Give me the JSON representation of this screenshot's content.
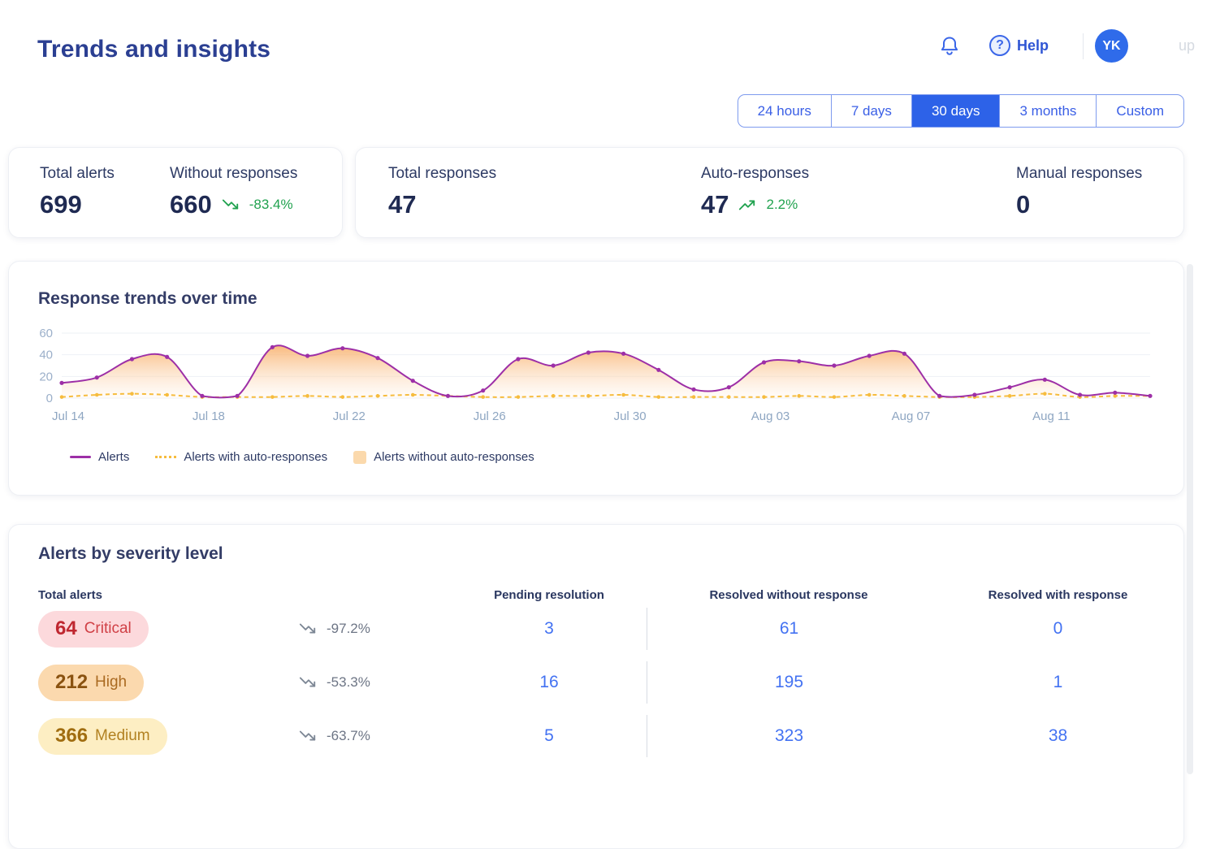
{
  "header": {
    "title": "Trends and insights",
    "help_label": "Help",
    "avatar_initials": "YK",
    "username_fragment": "up"
  },
  "time_tabs": {
    "options": [
      "24 hours",
      "7 days",
      "30 days",
      "3 months",
      "Custom"
    ],
    "active": "30 days"
  },
  "stats": {
    "total_alerts": {
      "label": "Total alerts",
      "value": "699"
    },
    "without_responses": {
      "label": "Without responses",
      "value": "660",
      "trend": "-83.4%",
      "trend_dir": "down",
      "trend_color": "#21a24f"
    },
    "total_responses": {
      "label": "Total responses",
      "value": "47"
    },
    "auto_responses": {
      "label": "Auto-responses",
      "value": "47",
      "trend": "2.2%",
      "trend_dir": "up",
      "trend_color": "#21a24f"
    },
    "manual_responses": {
      "label": "Manual responses",
      "value": "0"
    }
  },
  "chart_data": {
    "type": "area",
    "title": "Response trends over time",
    "n_points": 32,
    "x_label_indices": [
      0,
      4,
      8,
      12,
      16,
      20,
      24,
      28
    ],
    "x_labels": [
      "Jul 14",
      "Jul 18",
      "Jul 22",
      "Jul 26",
      "Jul 30",
      "Aug 03",
      "Aug 07",
      "Aug 11"
    ],
    "ylim": [
      0,
      60
    ],
    "yticks": [
      0,
      20,
      40,
      60
    ],
    "grid": "horizontal",
    "legend_position": "bottom-left",
    "series": [
      {
        "name": "Alerts",
        "color": "#9d2fa7",
        "style": "solid",
        "values": [
          14,
          19,
          36,
          38,
          2,
          2,
          47,
          39,
          46,
          37,
          16,
          2,
          7,
          36,
          30,
          42,
          41,
          26,
          8,
          10,
          33,
          34,
          30,
          39,
          41,
          2,
          3,
          10,
          17,
          3,
          5,
          2
        ]
      },
      {
        "name": "Alerts with auto-responses",
        "color": "#f6bc3e",
        "style": "dashed",
        "values": [
          1,
          3,
          4,
          3,
          1,
          1,
          1,
          2,
          1,
          2,
          3,
          2,
          1,
          1,
          2,
          2,
          3,
          1,
          1,
          1,
          1,
          2,
          1,
          3,
          2,
          1,
          1,
          2,
          4,
          1,
          2,
          2
        ]
      },
      {
        "name": "Alerts without auto-responses",
        "style": "area-fill-under-alerts",
        "color": "#f8ad66",
        "swatch_color": "#fbd9ac"
      }
    ]
  },
  "severity": {
    "title": "Alerts by severity level",
    "columns": [
      "Total alerts",
      "Pending resolution",
      "Resolved without response",
      "Resolved with response"
    ],
    "rows": [
      {
        "count": "64",
        "level": "Critical",
        "trend": "-97.2%",
        "pending": "3",
        "resolved_without": "61",
        "resolved_with": "0",
        "pill_bg": "#fcd9dc",
        "count_color": "#bf2730",
        "label_color": "#d04046"
      },
      {
        "count": "212",
        "level": "High",
        "trend": "-53.3%",
        "pending": "16",
        "resolved_without": "195",
        "resolved_with": "1",
        "pill_bg": "#fbd9ae",
        "count_color": "#8a5210",
        "label_color": "#aa6a21"
      },
      {
        "count": "366",
        "level": "Medium",
        "trend": "-63.7%",
        "pending": "5",
        "resolved_without": "323",
        "resolved_with": "38",
        "pill_bg": "#fdeec3",
        "count_color": "#a06d10",
        "label_color": "#b28121"
      }
    ]
  }
}
